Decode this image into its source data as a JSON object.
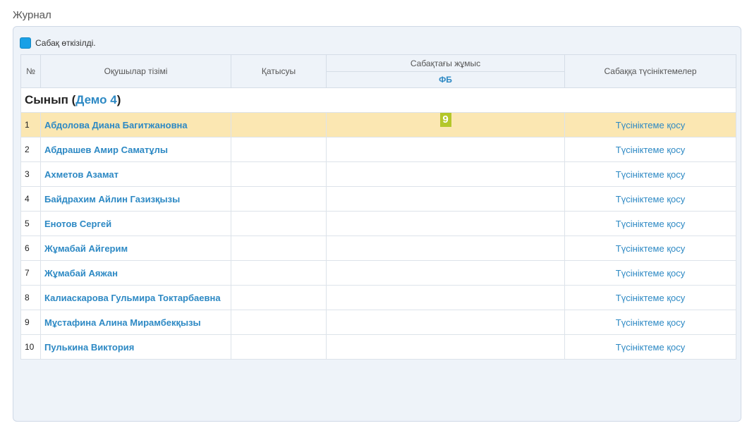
{
  "page": {
    "title": "Журнал"
  },
  "legend": {
    "label": "Сабақ өткізілді.",
    "color": "#1aa0e6"
  },
  "table": {
    "headers": {
      "num": "№",
      "students": "Оқушылар тізімі",
      "attendance": "Қатысуы",
      "lesson_work": "Сабақтағы жұмыс",
      "lesson_work_sub": "ФБ",
      "comments": "Сабаққа түсініктемелер"
    },
    "class_label": "Сынып",
    "class_name": "Демо 4",
    "rows": [
      {
        "num": "1",
        "name": "Абдолова Диана Багитжановна",
        "grade": "9",
        "comment": "Түсініктеме қосу"
      },
      {
        "num": "2",
        "name": "Абдрашев Амир Саматұлы",
        "grade": "",
        "comment": "Түсініктеме қосу"
      },
      {
        "num": "3",
        "name": "Ахметов Азамат",
        "grade": "",
        "comment": "Түсініктеме қосу"
      },
      {
        "num": "4",
        "name": "Байдрахим Айлин Газизқызы",
        "grade": "",
        "comment": "Түсініктеме қосу"
      },
      {
        "num": "5",
        "name": "Енотов Сергей",
        "grade": "",
        "comment": "Түсініктеме қосу"
      },
      {
        "num": "6",
        "name": "Жұмабай Айгерим",
        "grade": "",
        "comment": "Түсініктеме қосу"
      },
      {
        "num": "7",
        "name": "Жұмабай Аяжан",
        "grade": "",
        "comment": "Түсініктеме қосу"
      },
      {
        "num": "8",
        "name": "Калиаскарова Гульмира Токтарбаевна",
        "grade": "",
        "comment": "Түсініктеме қосу"
      },
      {
        "num": "9",
        "name": "Мұстафина Алина Мирамбекқызы",
        "grade": "",
        "comment": "Түсініктеме қосу"
      },
      {
        "num": "10",
        "name": "Пулькина Виктория",
        "grade": "",
        "comment": "Түсініктеме қосу"
      }
    ]
  },
  "colors": {
    "accent": "#2d89c4",
    "highlight_row": "#fbe7b2",
    "grade_badge": "#b4c72a"
  }
}
